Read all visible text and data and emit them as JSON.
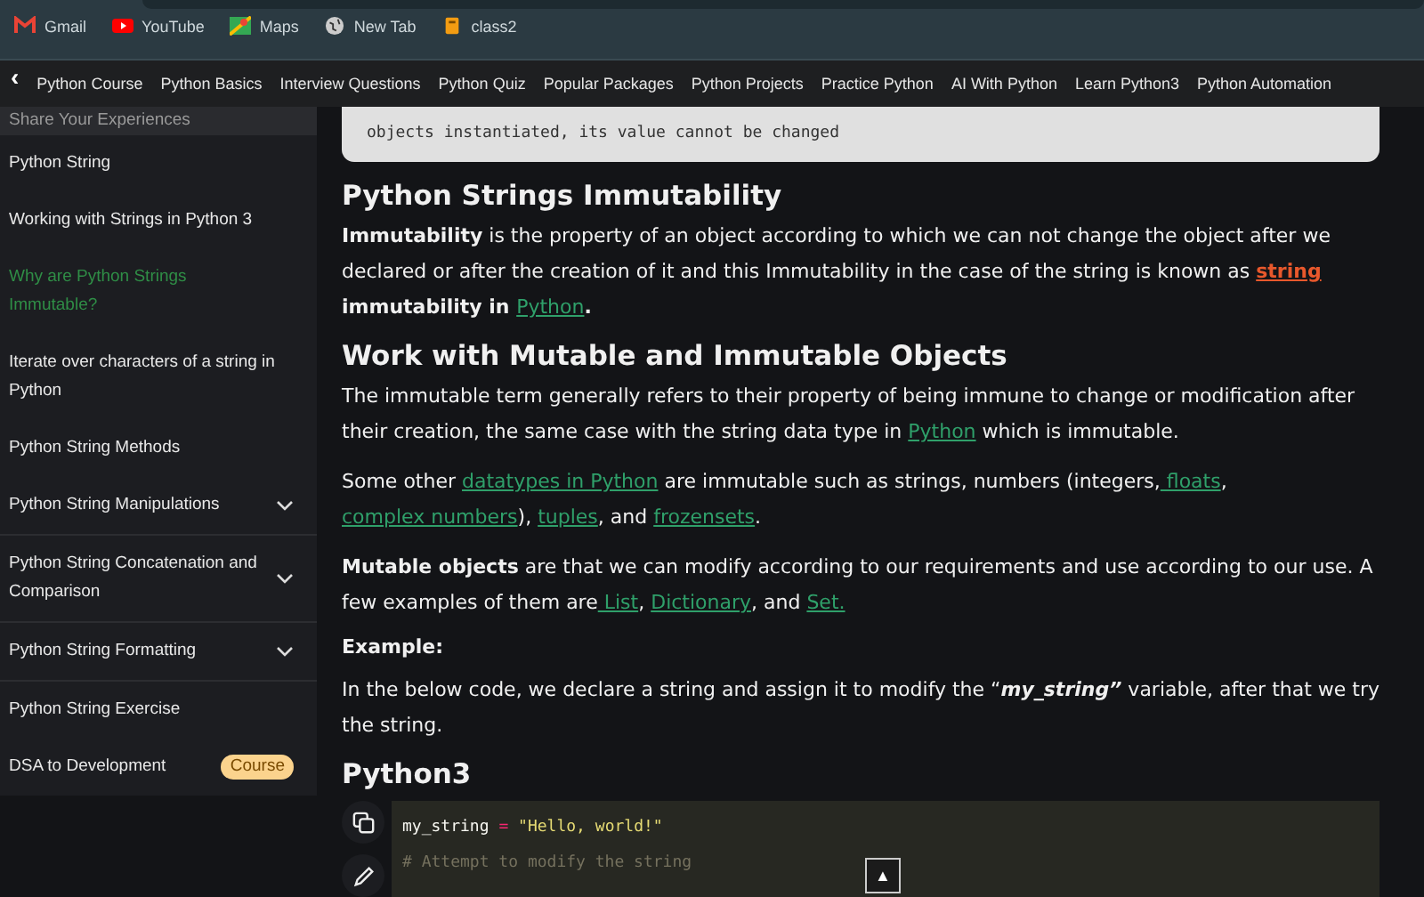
{
  "bookmarks": [
    {
      "label": "Gmail",
      "kind": "mail"
    },
    {
      "label": "YouTube",
      "kind": "video"
    },
    {
      "label": "Maps",
      "kind": "map"
    },
    {
      "label": "New Tab",
      "kind": "globe"
    },
    {
      "label": "class2",
      "kind": "book"
    }
  ],
  "nav": {
    "back": "‹",
    "items": [
      "Python Course",
      "Python Basics",
      "Interview Questions",
      "Python Quiz",
      "Popular Packages",
      "Python Projects",
      "Practice Python",
      "AI With Python",
      "Learn Python3",
      "Python Automation"
    ]
  },
  "sidebar": {
    "items": [
      {
        "label": "Share Your Experiences",
        "selected": false,
        "expandable": false
      },
      {
        "label": "Python String",
        "selected": false,
        "expandable": false
      },
      {
        "label": "Working with Strings in Python 3",
        "selected": false,
        "expandable": false
      },
      {
        "label": "Why are Python Strings Immutable?",
        "selected": true,
        "expandable": false
      },
      {
        "label": "Iterate over characters of a string in Python",
        "selected": false,
        "expandable": false
      },
      {
        "label": "Python String Methods",
        "selected": false,
        "expandable": false
      },
      {
        "label": "Python String Manipulations",
        "selected": false,
        "expandable": true
      },
      {
        "label": "Python String Concatenation and Comparison",
        "selected": false,
        "expandable": true
      },
      {
        "label": "Python String Formatting",
        "selected": false,
        "expandable": true
      },
      {
        "label": "Python String Exercise",
        "selected": false,
        "expandable": false
      },
      {
        "label": "DSA to Development",
        "selected": false,
        "expandable": false,
        "badge": "Course"
      }
    ]
  },
  "article": {
    "quote": "objects instantiated, its value cannot be changed",
    "blocks": [
      {
        "kind": "heading",
        "text": "Python Strings Immutability"
      },
      {
        "kind": "paragraph",
        "segments": [
          {
            "kind": "bold",
            "text": "Immutability"
          },
          {
            "kind": "text",
            "text": " is the property of an object according to which we can not change the object after we declared or after the creation of it and this Immutability in the case of the string is known as "
          },
          {
            "kind": "hot-link",
            "text": "string"
          },
          {
            "kind": "bold",
            "text": " immutability in "
          },
          {
            "kind": "link",
            "text": "Python"
          },
          {
            "kind": "bold",
            "text": "."
          }
        ]
      },
      {
        "kind": "heading",
        "text": "Work with Mutable and Immutable Objects"
      },
      {
        "kind": "paragraph",
        "segments": [
          {
            "kind": "text",
            "text": "The immutable term generally refers to their property of being immune to change or modification after their creation, the same case with the string data type in "
          },
          {
            "kind": "link",
            "text": "Python"
          },
          {
            "kind": "text",
            "text": " which is immutable."
          }
        ]
      },
      {
        "kind": "paragraph",
        "segments": [
          {
            "kind": "text",
            "text": "Some other "
          },
          {
            "kind": "link",
            "text": "datatypes in Python"
          },
          {
            "kind": "text",
            "text": " are immutable such as strings, numbers (integers,"
          },
          {
            "kind": "link",
            "text": " floats"
          },
          {
            "kind": "text",
            "text": ", "
          },
          {
            "kind": "link",
            "text": "complex numbers"
          },
          {
            "kind": "text",
            "text": "), "
          },
          {
            "kind": "link",
            "text": "tuples"
          },
          {
            "kind": "text",
            "text": ", and "
          },
          {
            "kind": "link",
            "text": "frozensets"
          },
          {
            "kind": "text",
            "text": "."
          }
        ]
      },
      {
        "kind": "paragraph",
        "segments": [
          {
            "kind": "bold",
            "text": "Mutable objects"
          },
          {
            "kind": "text",
            "text": " are that we can modify according to our requirements and use according to our use. A few examples of them are"
          },
          {
            "kind": "link",
            "text": " List"
          },
          {
            "kind": "text",
            "text": ", "
          },
          {
            "kind": "link",
            "text": "Dictionary"
          },
          {
            "kind": "text",
            "text": ", and "
          },
          {
            "kind": "link",
            "text": "Set."
          }
        ]
      },
      {
        "kind": "label",
        "text": "Example:"
      },
      {
        "kind": "paragraph",
        "segments": [
          {
            "kind": "text",
            "text": "In the below code, we declare a string and assign it to modify the “"
          },
          {
            "kind": "bold-italic",
            "text": "my_string”"
          },
          {
            "kind": "text",
            "text": " variable, after that we try the string."
          }
        ]
      },
      {
        "kind": "heading",
        "text": "Python3"
      }
    ],
    "code": [
      [
        {
          "kind": "name",
          "text": "my_string"
        },
        {
          "kind": "op",
          "text": " = "
        },
        {
          "kind": "string",
          "text": "\"Hello, world!\""
        }
      ],
      [
        {
          "kind": "comment",
          "text": "# Attempt to modify the string"
        }
      ]
    ],
    "scroll_top": "▲"
  }
}
